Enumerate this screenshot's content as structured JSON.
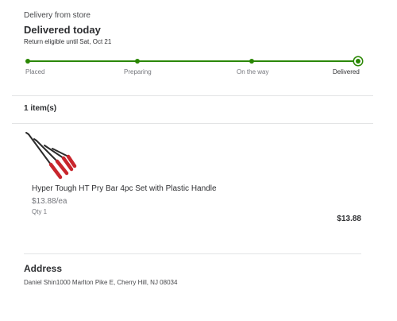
{
  "delivery": {
    "eyebrow": "Delivery from store",
    "status_title": "Delivered today",
    "return_note": "Return eligible until Sat, Oct 21",
    "progress": 1.0,
    "steps": [
      {
        "label": "Placed",
        "completed": true
      },
      {
        "label": "Preparing",
        "completed": true
      },
      {
        "label": "On the way",
        "completed": true
      },
      {
        "label": "Delivered",
        "completed": true,
        "current": true
      }
    ]
  },
  "items": {
    "heading": "1 item(s)",
    "list": [
      {
        "image_icon": "pry-bar-set-image",
        "name": "Hyper Tough HT Pry Bar 4pc Set with Plastic Handle",
        "unit_price": "$13.88/ea",
        "qty": "Qty 1",
        "total": "$13.88"
      }
    ]
  },
  "address": {
    "heading": "Address",
    "line": "Daniel Shin1000 Marlton Pike E, Cherry Hill, NJ 08034"
  },
  "colors": {
    "progress_green": "#2a8703",
    "handle_red": "#c8252c",
    "text_dark": "#2e2f32",
    "text_muted": "#74767c",
    "divider": "#e3e4e5"
  }
}
